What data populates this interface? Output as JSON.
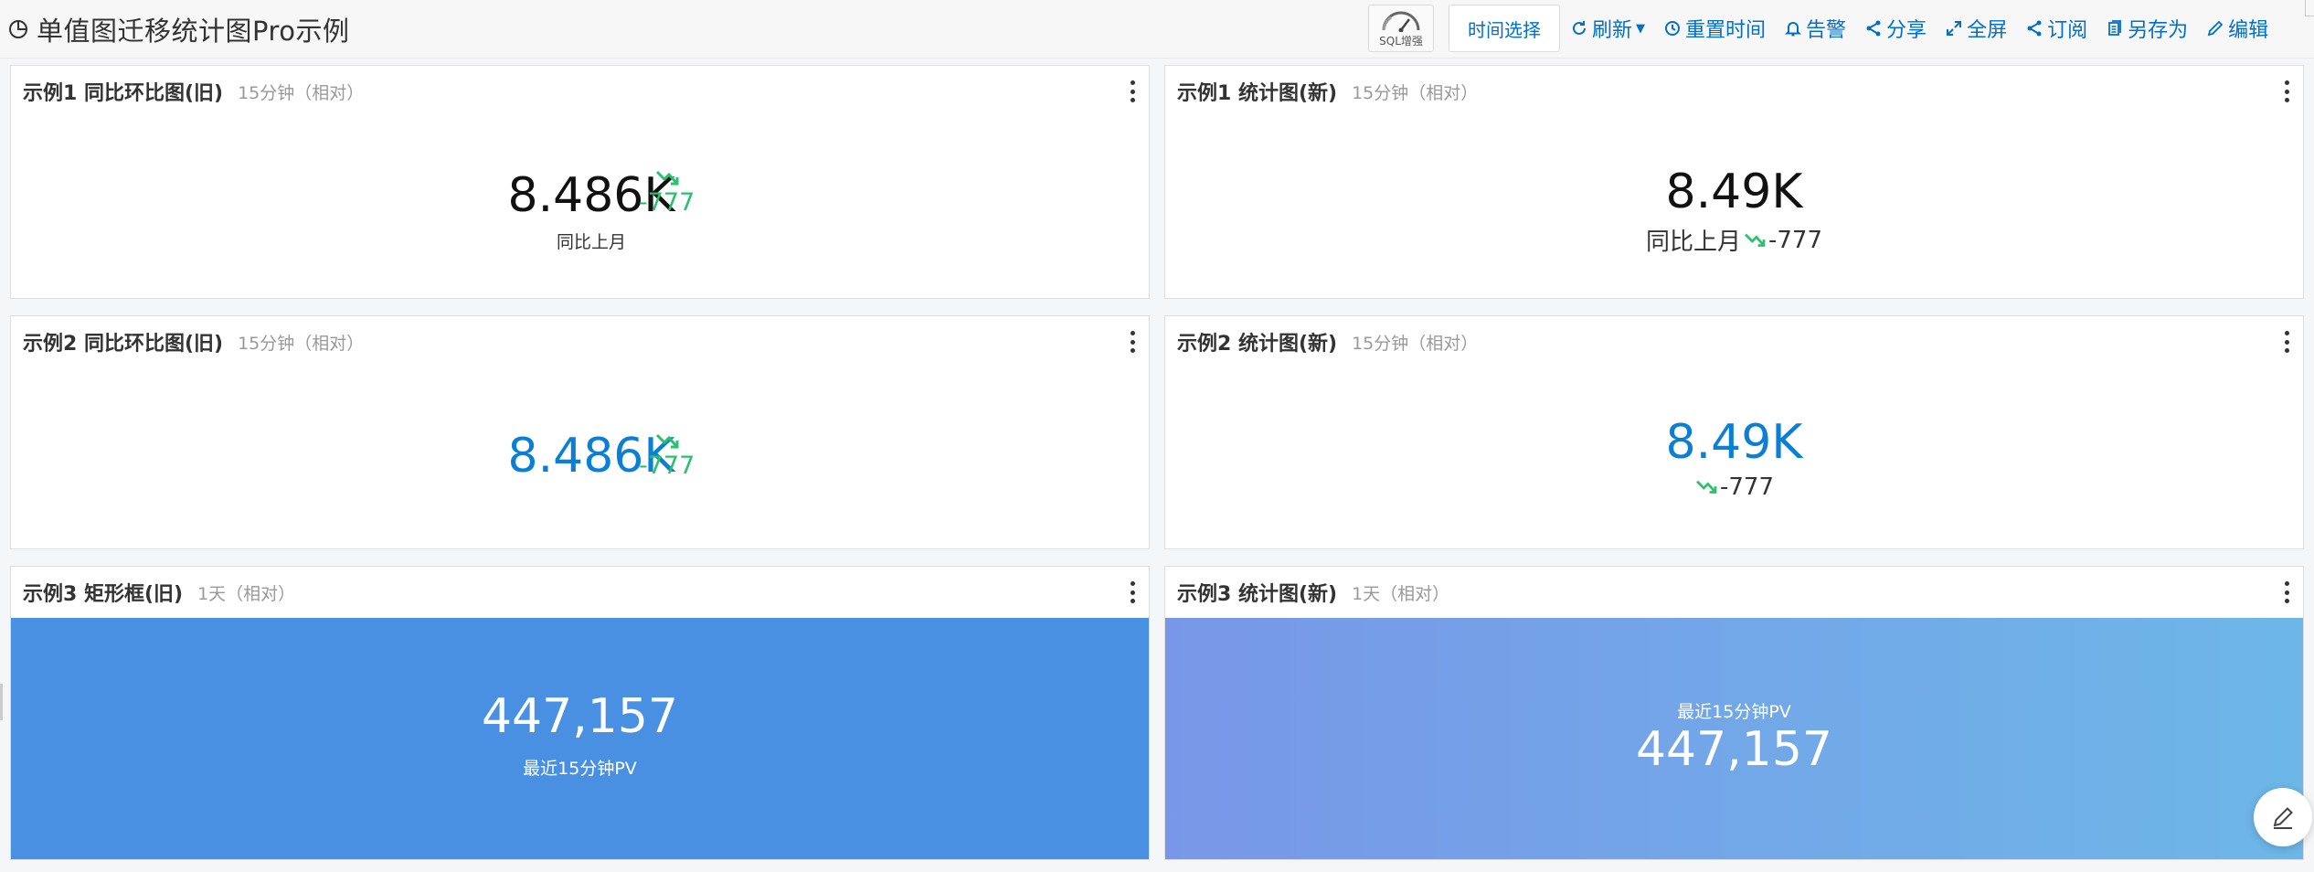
{
  "header": {
    "title": "单值图迁移统计图Pro示例",
    "sql_label": "SQL增强",
    "time_select": "时间选择",
    "tools": [
      {
        "icon": "refresh-icon",
        "label": "刷新",
        "has_caret": true
      },
      {
        "icon": "history-icon",
        "label": "重置时间"
      },
      {
        "icon": "bell-icon",
        "label": "告警"
      },
      {
        "icon": "share-icon",
        "label": "分享"
      },
      {
        "icon": "fullscreen-icon",
        "label": "全屏"
      },
      {
        "icon": "subscribe-icon",
        "label": "订阅"
      },
      {
        "icon": "save-as-icon",
        "label": "另存为"
      },
      {
        "icon": "edit-icon",
        "label": "编辑"
      }
    ]
  },
  "panels": {
    "p1_old": {
      "title": "示例1 同比环比图(旧)",
      "time": "15分钟（相对）",
      "value": "8.486K",
      "label": "同比上月",
      "delta": "-777"
    },
    "p1_new": {
      "title": "示例1 统计图(新)",
      "time": "15分钟（相对）",
      "value": "8.49K",
      "label": "同比上月",
      "delta": "-777"
    },
    "p2_old": {
      "title": "示例2 同比环比图(旧)",
      "time": "15分钟（相对）",
      "value": "8.486K",
      "delta": "-777"
    },
    "p2_new": {
      "title": "示例2 统计图(新)",
      "time": "15分钟（相对）",
      "value": "8.49K",
      "delta": "-777"
    },
    "p3_old": {
      "title": "示例3 矩形框(旧)",
      "time": "1天（相对）",
      "value": "447,157",
      "label": "最近15分钟PV"
    },
    "p3_new": {
      "title": "示例3 统计图(新)",
      "time": "1天（相对）",
      "value": "447,157",
      "label": "最近15分钟PV"
    }
  },
  "colors": {
    "accent": "#0070cc",
    "trend_down": "#2bc16e",
    "value_blue": "#0b7fd4",
    "rect_fill": "#4a90e2",
    "gradient_start": "#7897e8",
    "gradient_end": "#6db7e8"
  }
}
